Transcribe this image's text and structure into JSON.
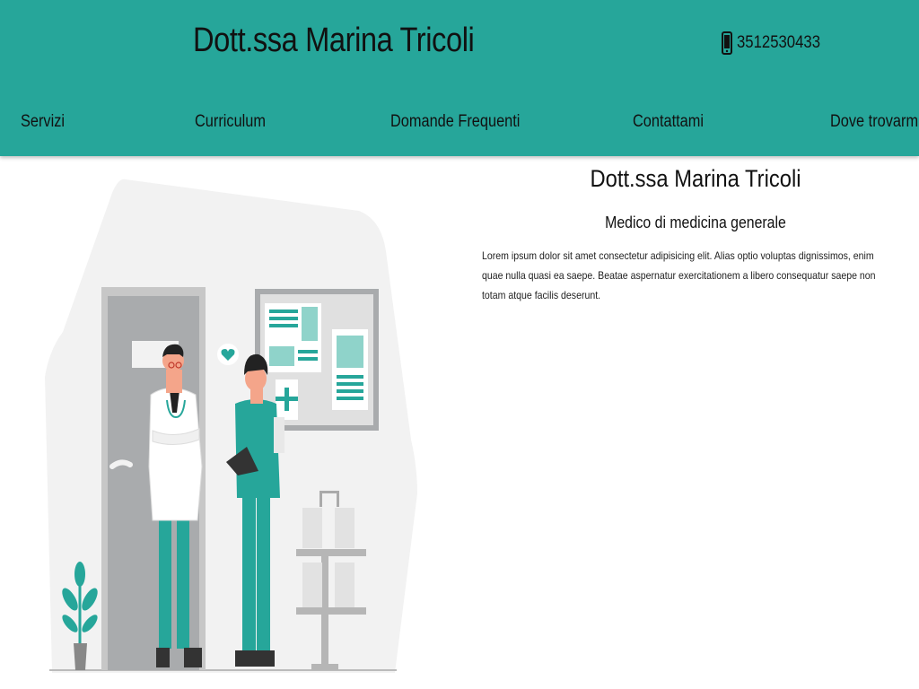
{
  "header": {
    "title": "Dott.ssa Marina Tricoli",
    "phone": "3512530433",
    "phone_icon": "phone-icon"
  },
  "nav": {
    "items": [
      {
        "label": "Servizi"
      },
      {
        "label": "Curriculum"
      },
      {
        "label": "Domande Frequenti"
      },
      {
        "label": "Contattami"
      },
      {
        "label": "Dove trovarmi"
      }
    ]
  },
  "main": {
    "title": "Dott.ssa Marina Tricoli",
    "subtitle": "Medico di medicina generale",
    "body": "Lorem ipsum dolor sit amet consectetur adipisicing elit. Alias optio voluptas dignissimos, enim quae nulla quasi ea saepe. Beatae aspernatur exercitationem a libero consequatur saepe non totam atque facilis deserunt."
  },
  "colors": {
    "header_bg": "#26a69a",
    "accent": "#26a69a"
  }
}
